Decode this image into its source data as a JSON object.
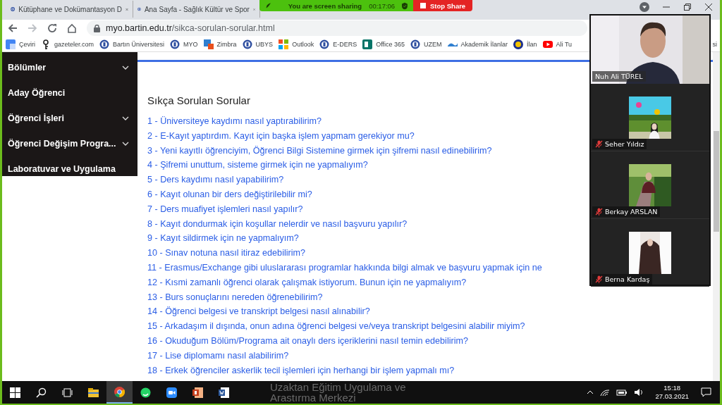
{
  "sharing_bar": {
    "message": "You are screen sharing",
    "timer": "00:17:06",
    "stop_label": "Stop Share"
  },
  "browser": {
    "tabs": [
      {
        "title": "Kütüphane ve Dokümantasyon D",
        "selected": false
      },
      {
        "title": "Ana Sayfa - Sağlık Kültür ve Spor",
        "selected": false
      }
    ],
    "url_host": "myo.bartin.edu.tr",
    "url_path": "/sikca-sorulan-sorular.html",
    "bookmarks": [
      {
        "label": "Çeviri"
      },
      {
        "label": "gazeteler.com"
      },
      {
        "label": "Bartın Üniversitesi"
      },
      {
        "label": "MYO"
      },
      {
        "label": "Zimbra"
      },
      {
        "label": "UBYS"
      },
      {
        "label": "Outlook"
      },
      {
        "label": "E-DERS"
      },
      {
        "label": "Office 365"
      },
      {
        "label": "UZEM"
      },
      {
        "label": "Akademik İlanlar"
      },
      {
        "label": "İlan"
      },
      {
        "label": "Ali Tu"
      },
      {
        "label": "si"
      }
    ]
  },
  "sidebar": {
    "items": [
      {
        "label": "Bölümler",
        "expandable": true
      },
      {
        "label": "Aday Öğrenci",
        "expandable": false
      },
      {
        "label": "Öğrenci İşleri",
        "expandable": true
      },
      {
        "label": "Öğrenci Değişim Progra...",
        "expandable": true
      },
      {
        "label": "Laboratuvar ve Uygulama",
        "expandable": false
      }
    ]
  },
  "faq": {
    "title": "Sıkça Sorulan Sorular",
    "questions": [
      "1 - Üniversiteye kaydımı nasıl yaptırabilirim?",
      "2 - E-Kayıt yaptırdım. Kayıt için başka işlem yapmam gerekiyor mu?",
      "3 - Yeni kayıtlı öğrenciyim, Öğrenci Bilgi Sistemine girmek için şifremi nasıl edinebilirim?",
      "4 - Şifremi unuttum, sisteme girmek için ne yapmalıyım?",
      "5 - Ders kaydımı nasıl yapabilirim?",
      "6 - Kayıt olunan bir ders değiştirilebilir mi?",
      "7 - Ders muafiyet işlemleri nasıl yapılır?",
      "8 - Kayıt dondurmak için koşullar nelerdir ve nasıl başvuru yapılır?",
      "9 - Kayıt sildirmek için ne yapmalıyım?",
      "10 - Sınav notuna nasıl itiraz edebilirim?",
      "11 - Erasmus/Exchange gibi uluslararası programlar hakkında bilgi almak ve başvuru yapmak için ne",
      "12 - Kısmi zamanlı öğrenci olarak çalışmak istiyorum. Bunun için ne yapmalıyım?",
      "13 - Burs sonuçlarını nereden öğrenebilirim?",
      "14 - Öğrenci belgesi ve transkript belgesi nasıl alınabilir?",
      "15 - Arkadaşım il dışında, onun adına öğrenci belgesi ve/veya transkript belgesini  alabilir miyim?",
      "16 - Okuduğum Bölüm/Programa ait onaylı ders içeriklerini nasıl temin edebilirim?",
      "17 - Lise diplomamı nasıl alabilirim?",
      "18 - Erkek öğrenciler askerlik tecil işlemleri için herhangi bir işlem yapmalı mı?"
    ]
  },
  "footer_heading": [
    "Uzaktan Eğitim Uygulama ve",
    "Arastırma Merkezi"
  ],
  "participants": [
    {
      "name": "Nuh Ali TÜREL",
      "muted": false,
      "kind": "video"
    },
    {
      "name": "Seher Yıldız",
      "muted": true
    },
    {
      "name": "Berkay ARSLAN",
      "muted": true
    },
    {
      "name": "Berna Kardaş",
      "muted": true
    }
  ],
  "taskbar": {
    "apps": [
      {
        "active": false
      },
      {
        "active": false
      },
      {
        "active": false
      },
      {
        "active": false
      },
      {
        "active": true
      },
      {
        "active": false
      },
      {
        "active": false
      },
      {
        "active": false
      },
      {
        "active": false
      }
    ],
    "time": "15:18",
    "date": "27.03.2021"
  }
}
